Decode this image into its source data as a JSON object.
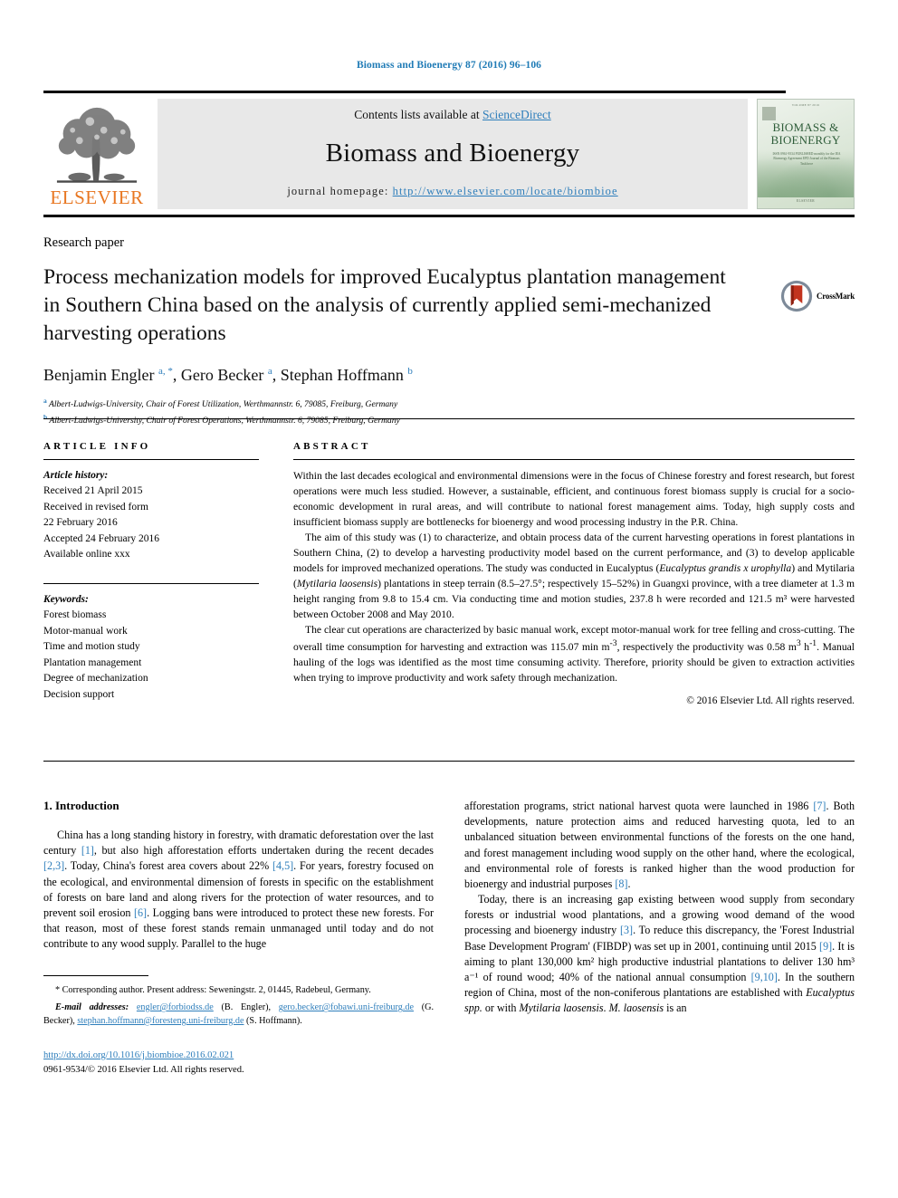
{
  "running_head": "Biomass and Bioenergy 87 (2016) 96–106",
  "publisher_header": {
    "contents_line_prefix": "Contents lists available at ",
    "sciencedirect": "ScienceDirect",
    "journal_name": "Biomass and Bioenergy",
    "homepage_label": "journal homepage:",
    "homepage_url": "http://www.elsevier.com/locate/biombioe",
    "elsevier_wordmark": "ELSEVIER",
    "cover": {
      "title_line1": "BIOMASS &",
      "title_line2": "BIOENERGY",
      "subtitle": "ISSN 0961-9534 PUBLISHED\nmonthly for the IEA Bioenergy Agreement\nEPD Journal of the Biomass Taskforce",
      "footer": "ELSEVIER",
      "top_note": "VOLUME 87 2016"
    }
  },
  "article": {
    "type": "Research paper",
    "title": "Process mechanization models for improved Eucalyptus plantation management in Southern China based on the analysis of currently applied semi-mechanized harvesting operations",
    "crossmark_label": "CrossMark",
    "authors_html": "Benjamin Engler <sup>a, *</sup>, Gero Becker <sup>a</sup>, Stephan Hoffmann <sup>b</sup>",
    "affiliation_a": "Albert-Ludwigs-University, Chair of Forest Utilization, Werthmannstr. 6, 79085, Freiburg, Germany",
    "affiliation_b": "Albert-Ludwigs-University, Chair of Forest Operations, Werthmannstr. 6, 79085, Freiburg, Germany",
    "affiliation_a_mark": "a",
    "affiliation_b_mark": "b"
  },
  "article_info": {
    "heading": "ARTICLE INFO",
    "history_label": "Article history:",
    "history": [
      "Received 21 April 2015",
      "Received in revised form",
      "22 February 2016",
      "Accepted 24 February 2016",
      "Available online xxx"
    ],
    "keywords_label": "Keywords:",
    "keywords": [
      "Forest biomass",
      "Motor-manual work",
      "Time and motion study",
      "Plantation management",
      "Degree of mechanization",
      "Decision support"
    ]
  },
  "abstract": {
    "heading": "ABSTRACT",
    "para1": "Within the last decades ecological and environmental dimensions were in the focus of Chinese forestry and forest research, but forest operations were much less studied. However, a sustainable, efficient, and continuous forest biomass supply is crucial for a socio-economic development in rural areas, and will contribute to national forest management aims. Today, high supply costs and insufficient biomass supply are bottlenecks for bioenergy and wood processing industry in the P.R. China.",
    "para2_a": "The aim of this study was (1) to characterize, and obtain process data of the current harvesting operations in forest plantations in Southern China, (2) to develop a harvesting productivity model based on the current performance, and (3) to develop applicable models for improved mechanized operations. The study was conducted in Eucalyptus (",
    "para2_sp1": "Eucalyptus grandis x urophylla",
    "para2_b": ") and Mytilaria (",
    "para2_sp2": "Mytilaria laosensis",
    "para2_c": ") plantations in steep terrain (8.5–27.5°; respectively 15–52%) in Guangxi province, with a tree diameter at 1.3 m height ranging from 9.8 to 15.4 cm. Via conducting time and motion studies, 237.8 h were recorded and 121.5 m³ were harvested between October 2008 and May 2010.",
    "para3_a": "The clear cut operations are characterized by basic manual work, except motor-manual work for tree felling and cross-cutting. The overall time consumption for harvesting and extraction was 115.07 min m",
    "para3_sup1": "-3",
    "para3_b": ", respectively the productivity was 0.58 m",
    "para3_sup2": "3",
    "para3_c": " h",
    "para3_sup3": "-1",
    "para3_d": ". Manual hauling of the logs was identified as the most time consuming activity. Therefore, priority should be given to extraction activities when trying to improve productivity and work safety through mechanization.",
    "copyright": "© 2016 Elsevier Ltd. All rights reserved."
  },
  "introduction": {
    "section_title": "1. Introduction",
    "left_para1_parts": [
      {
        "t": "China has a long standing history in forestry, with dramatic deforestation over the last century "
      },
      {
        "t": "[1]",
        "ref": true
      },
      {
        "t": ", but also high afforestation efforts undertaken during the recent decades "
      },
      {
        "t": "[2,3]",
        "ref": true
      },
      {
        "t": ". Today, China's forest area covers about 22% "
      },
      {
        "t": "[4,5]",
        "ref": true
      },
      {
        "t": ". For years, forestry focused on the ecological, and environmental dimension of forests in specific on the establishment of forests on bare land and along rivers for the protection of water resources, and to prevent soil erosion "
      },
      {
        "t": "[6]",
        "ref": true
      },
      {
        "t": ". Logging bans were introduced to protect these new forests. For that reason, most of these forest stands remain unmanaged until today and do not contribute to any wood supply. Parallel to the huge"
      }
    ],
    "right_para1_parts": [
      {
        "t": "afforestation programs, strict national harvest quota were launched in 1986 "
      },
      {
        "t": "[7]",
        "ref": true
      },
      {
        "t": ". Both developments, nature protection aims and reduced harvesting quota, led to an unbalanced situation between environmental functions of the forests on the one hand, and forest management including wood supply on the other hand, where the ecological, and environmental role of forests is ranked higher than the wood production for bioenergy and industrial purposes "
      },
      {
        "t": "[8]",
        "ref": true
      },
      {
        "t": "."
      }
    ],
    "right_para2_parts": [
      {
        "t": "Today, there is an increasing gap existing between wood supply from secondary forests or industrial wood plantations, and a growing wood demand of the wood processing and bioenergy industry "
      },
      {
        "t": "[3]",
        "ref": true
      },
      {
        "t": ". To reduce this discrepancy, the 'Forest Industrial Base Development Program' (FIBDP) was set up in 2001, continuing until 2015 "
      },
      {
        "t": "[9]",
        "ref": true
      },
      {
        "t": ". It is aiming to plant 130,000 km² high productive industrial plantations to deliver 130 hm³ a⁻¹ of round wood; 40% of the national annual consumption "
      },
      {
        "t": "[9,10]",
        "ref": true
      },
      {
        "t": ". In the southern region of China, most of the non-coniferous plantations are established with "
      },
      {
        "t": "Eucalyptus spp.",
        "ital": true
      },
      {
        "t": " or with "
      },
      {
        "t": "Mytilaria laosensis",
        "ital": true
      },
      {
        "t": ". "
      },
      {
        "t": "M. laosensis",
        "ital": true
      },
      {
        "t": " is an"
      }
    ]
  },
  "footnotes": {
    "corresponding_marker": "*",
    "corresponding": "Corresponding author. Present address: Seweningstr. 2, 01445, Radebeul, Germany.",
    "emails_label": "E-mail addresses:",
    "emails": [
      {
        "addr": "engler@forbiodss.de",
        "who": "(B. Engler)"
      },
      {
        "addr": "gero.becker@fobawi.uni-freiburg.de",
        "who": "(G. Becker)"
      },
      {
        "addr": "stephan.hoffmann@foresteng.uni-freiburg.de",
        "who": "(S. Hoffmann)"
      }
    ],
    "doi_url": "http://dx.doi.org/10.1016/j.biombioe.2016.02.021",
    "issn_line": "0961-9534/© 2016 Elsevier Ltd. All rights reserved."
  },
  "colors": {
    "link_blue": "#2e7ebb",
    "running_head_blue": "#1f7bb6",
    "elsevier_orange": "#E87722",
    "cover_green": "#2f5d3a"
  }
}
